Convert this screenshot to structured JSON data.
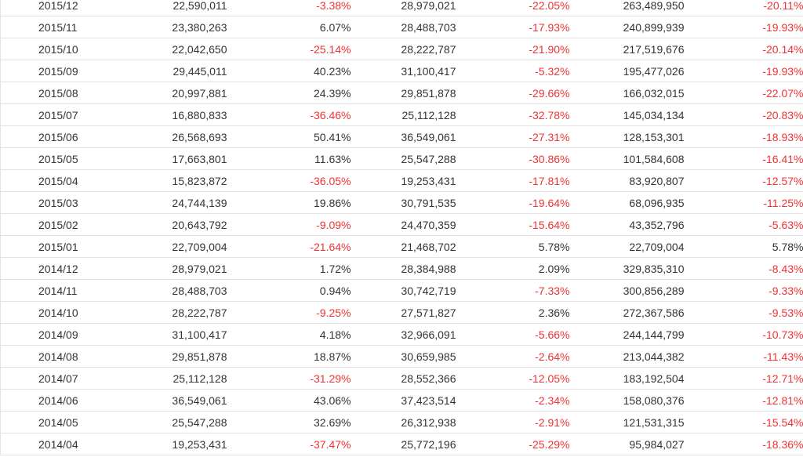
{
  "colors": {
    "negative": "#ee3333",
    "text": "#333333",
    "border": "#e2e2e2"
  },
  "rows": [
    {
      "month": "2015/12",
      "value": "22,590,011",
      "mom": "-3.38%",
      "prev_value": "28,979,021",
      "yoy": "-22.05%",
      "cumulative": "263,489,950",
      "cumulative_yoy": "-20.11%"
    },
    {
      "month": "2015/11",
      "value": "23,380,263",
      "mom": "6.07%",
      "prev_value": "28,488,703",
      "yoy": "-17.93%",
      "cumulative": "240,899,939",
      "cumulative_yoy": "-19.93%"
    },
    {
      "month": "2015/10",
      "value": "22,042,650",
      "mom": "-25.14%",
      "prev_value": "28,222,787",
      "yoy": "-21.90%",
      "cumulative": "217,519,676",
      "cumulative_yoy": "-20.14%"
    },
    {
      "month": "2015/09",
      "value": "29,445,011",
      "mom": "40.23%",
      "prev_value": "31,100,417",
      "yoy": "-5.32%",
      "cumulative": "195,477,026",
      "cumulative_yoy": "-19.93%"
    },
    {
      "month": "2015/08",
      "value": "20,997,881",
      "mom": "24.39%",
      "prev_value": "29,851,878",
      "yoy": "-29.66%",
      "cumulative": "166,032,015",
      "cumulative_yoy": "-22.07%"
    },
    {
      "month": "2015/07",
      "value": "16,880,833",
      "mom": "-36.46%",
      "prev_value": "25,112,128",
      "yoy": "-32.78%",
      "cumulative": "145,034,134",
      "cumulative_yoy": "-20.83%"
    },
    {
      "month": "2015/06",
      "value": "26,568,693",
      "mom": "50.41%",
      "prev_value": "36,549,061",
      "yoy": "-27.31%",
      "cumulative": "128,153,301",
      "cumulative_yoy": "-18.93%"
    },
    {
      "month": "2015/05",
      "value": "17,663,801",
      "mom": "11.63%",
      "prev_value": "25,547,288",
      "yoy": "-30.86%",
      "cumulative": "101,584,608",
      "cumulative_yoy": "-16.41%"
    },
    {
      "month": "2015/04",
      "value": "15,823,872",
      "mom": "-36.05%",
      "prev_value": "19,253,431",
      "yoy": "-17.81%",
      "cumulative": "83,920,807",
      "cumulative_yoy": "-12.57%"
    },
    {
      "month": "2015/03",
      "value": "24,744,139",
      "mom": "19.86%",
      "prev_value": "30,791,535",
      "yoy": "-19.64%",
      "cumulative": "68,096,935",
      "cumulative_yoy": "-11.25%"
    },
    {
      "month": "2015/02",
      "value": "20,643,792",
      "mom": "-9.09%",
      "prev_value": "24,470,359",
      "yoy": "-15.64%",
      "cumulative": "43,352,796",
      "cumulative_yoy": "-5.63%"
    },
    {
      "month": "2015/01",
      "value": "22,709,004",
      "mom": "-21.64%",
      "prev_value": "21,468,702",
      "yoy": "5.78%",
      "cumulative": "22,709,004",
      "cumulative_yoy": "5.78%"
    },
    {
      "month": "2014/12",
      "value": "28,979,021",
      "mom": "1.72%",
      "prev_value": "28,384,988",
      "yoy": "2.09%",
      "cumulative": "329,835,310",
      "cumulative_yoy": "-8.43%"
    },
    {
      "month": "2014/11",
      "value": "28,488,703",
      "mom": "0.94%",
      "prev_value": "30,742,719",
      "yoy": "-7.33%",
      "cumulative": "300,856,289",
      "cumulative_yoy": "-9.33%"
    },
    {
      "month": "2014/10",
      "value": "28,222,787",
      "mom": "-9.25%",
      "prev_value": "27,571,827",
      "yoy": "2.36%",
      "cumulative": "272,367,586",
      "cumulative_yoy": "-9.53%"
    },
    {
      "month": "2014/09",
      "value": "31,100,417",
      "mom": "4.18%",
      "prev_value": "32,966,091",
      "yoy": "-5.66%",
      "cumulative": "244,144,799",
      "cumulative_yoy": "-10.73%"
    },
    {
      "month": "2014/08",
      "value": "29,851,878",
      "mom": "18.87%",
      "prev_value": "30,659,985",
      "yoy": "-2.64%",
      "cumulative": "213,044,382",
      "cumulative_yoy": "-11.43%"
    },
    {
      "month": "2014/07",
      "value": "25,112,128",
      "mom": "-31.29%",
      "prev_value": "28,552,366",
      "yoy": "-12.05%",
      "cumulative": "183,192,504",
      "cumulative_yoy": "-12.71%"
    },
    {
      "month": "2014/06",
      "value": "36,549,061",
      "mom": "43.06%",
      "prev_value": "37,423,514",
      "yoy": "-2.34%",
      "cumulative": "158,080,376",
      "cumulative_yoy": "-12.81%"
    },
    {
      "month": "2014/05",
      "value": "25,547,288",
      "mom": "32.69%",
      "prev_value": "26,312,938",
      "yoy": "-2.91%",
      "cumulative": "121,531,315",
      "cumulative_yoy": "-15.54%"
    },
    {
      "month": "2014/04",
      "value": "19,253,431",
      "mom": "-37.47%",
      "prev_value": "25,772,196",
      "yoy": "-25.29%",
      "cumulative": "95,984,027",
      "cumulative_yoy": "-18.36%"
    }
  ]
}
